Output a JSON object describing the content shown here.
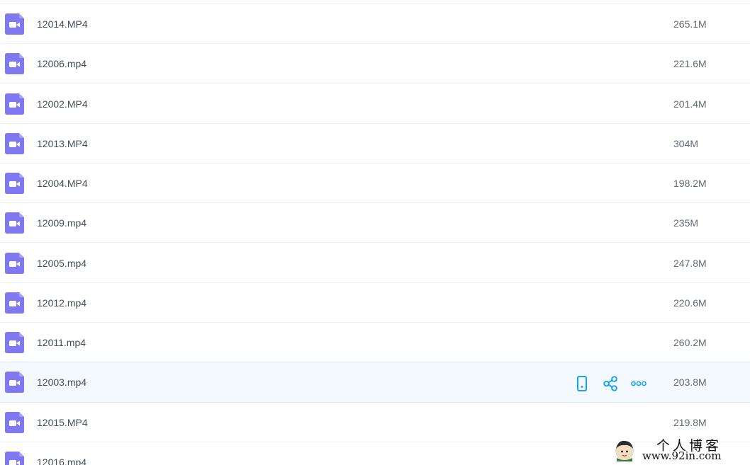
{
  "file_list": {
    "files": [
      {
        "name": "12014.MP4",
        "size": "265.1M"
      },
      {
        "name": "12006.mp4",
        "size": "221.6M"
      },
      {
        "name": "12002.MP4",
        "size": "201.4M"
      },
      {
        "name": "12013.MP4",
        "size": "304M"
      },
      {
        "name": "12004.MP4",
        "size": "198.2M"
      },
      {
        "name": "12009.mp4",
        "size": "235M"
      },
      {
        "name": "12005.mp4",
        "size": "247.8M"
      },
      {
        "name": "12012.mp4",
        "size": "220.6M"
      },
      {
        "name": "12011.mp4",
        "size": "260.2M"
      },
      {
        "name": "12003.mp4",
        "size": "203.8M"
      },
      {
        "name": "12015.MP4",
        "size": "219.8M"
      },
      {
        "name": "12016.mp4",
        "size": ""
      }
    ],
    "hovered_index": 9,
    "row_actions": [
      "phone-icon",
      "share-icon",
      "more-icon"
    ]
  },
  "watermark": {
    "title": "个人博客",
    "url": "www.92in.com"
  },
  "colors": {
    "video_icon": "#7f78f0",
    "action_icon": "#1aa3ea",
    "hover_bg": "#f3f9fe",
    "divider": "#eef0f4"
  }
}
